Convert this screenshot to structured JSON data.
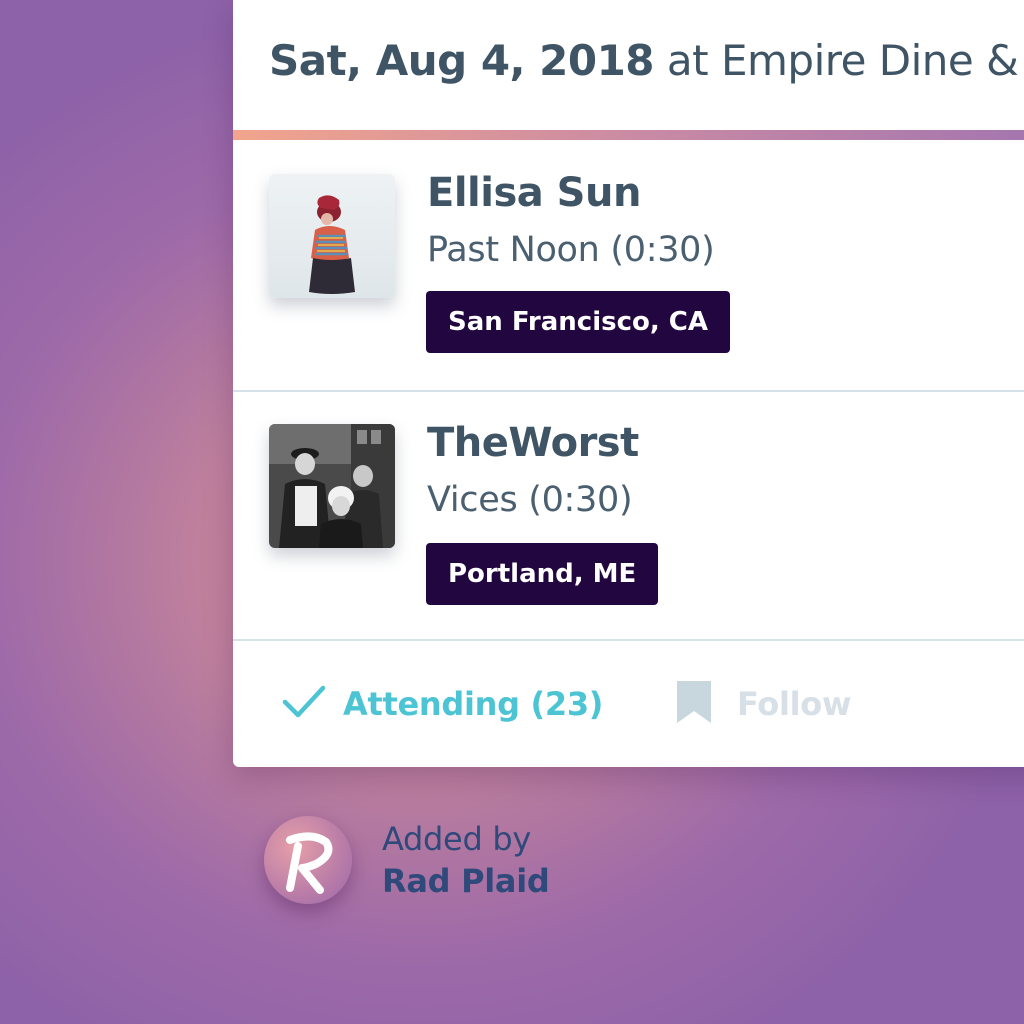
{
  "event": {
    "date": "Sat, Aug 4, 2018",
    "venue_text": "at Empire Dine & Da"
  },
  "artists": [
    {
      "name": "Ellisa Sun",
      "song": "Past Noon (0:30)",
      "location": "San Francisco, CA",
      "photo": "artist-photo-icon"
    },
    {
      "name": "TheWorst",
      "song": "Vices (0:30)",
      "location": "Portland, ME",
      "photo": "band-photo-icon"
    }
  ],
  "actions": {
    "attending_label": "Attending (23)",
    "follow_label": "Follow",
    "attending_icon": "checkmark-icon",
    "follow_icon": "bookmark-icon"
  },
  "footer": {
    "added_by_label": "Added by",
    "added_by_name": "Rad Plaid",
    "logo_icon": "rad-plaid-logo"
  },
  "colors": {
    "text_dark": "#3f5566",
    "badge_bg": "#22063f",
    "accent_teal": "#4cc4d4",
    "follow_muted": "#d6e0e6",
    "gradient_start": "#f2a58c",
    "gradient_end": "#a275b0",
    "footer_text": "#2f4a7a"
  }
}
